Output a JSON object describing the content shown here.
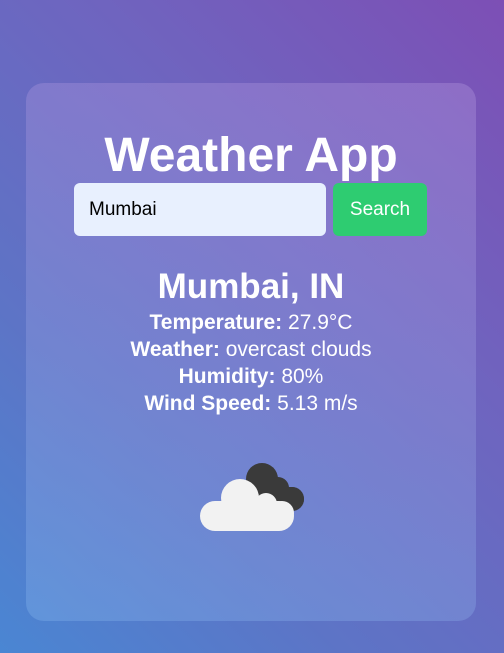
{
  "app": {
    "title": "Weather App"
  },
  "search": {
    "value": "Mumbai",
    "button_label": "Search"
  },
  "result": {
    "location": "Mumbai, IN",
    "rows": [
      {
        "label": "Temperature:",
        "value": "27.9°C"
      },
      {
        "label": "Weather:",
        "value": "overcast clouds"
      },
      {
        "label": "Humidity:",
        "value": "80%"
      },
      {
        "label": "Wind Speed:",
        "value": "5.13 m/s"
      }
    ],
    "icon": "overcast-clouds-icon"
  }
}
